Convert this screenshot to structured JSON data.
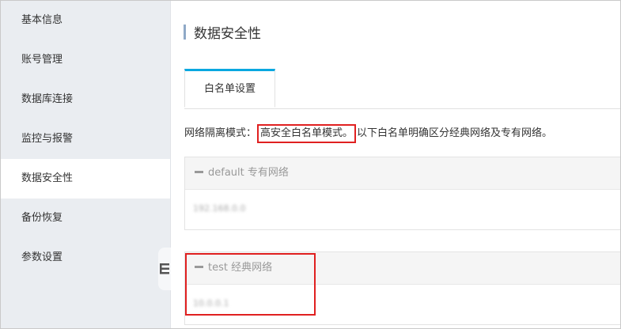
{
  "sidebar": {
    "items": [
      {
        "label": "基本信息"
      },
      {
        "label": "账号管理"
      },
      {
        "label": "数据库连接"
      },
      {
        "label": "监控与报警"
      },
      {
        "label": "数据安全性",
        "active": true
      },
      {
        "label": "备份恢复"
      },
      {
        "label": "参数设置"
      }
    ]
  },
  "main": {
    "title": "数据安全性",
    "tabs": [
      {
        "label": "白名单设置",
        "active": true
      }
    ],
    "mode": {
      "label": "网络隔离模式：",
      "value": "高安全白名单模式。",
      "description": "以下白名单明确区分经典网络及专有网络。"
    },
    "groups": [
      {
        "name": "default",
        "type": "专有网络",
        "ip": "192.168.0.0"
      },
      {
        "name": "test",
        "type": "经典网络",
        "ip": "10.0.0.1"
      }
    ]
  },
  "colors": {
    "accent": "#0aa8e0",
    "highlight_border": "#e02020",
    "sidebar_bg": "#eaedf1"
  },
  "icons": {
    "group_toggle": "minus-icon",
    "collapse": "sidebar-collapse-icon"
  }
}
